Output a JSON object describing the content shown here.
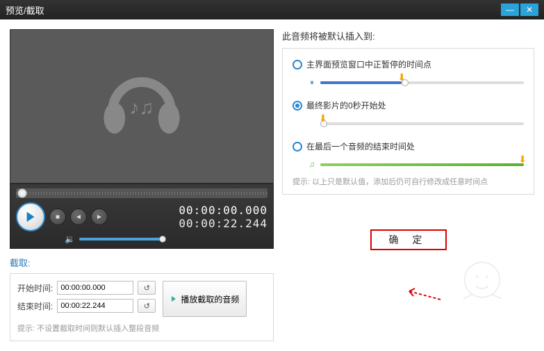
{
  "window": {
    "title": "预览/截取"
  },
  "preview": {
    "time_current": "00:00:00.000",
    "time_total": "00:00:22.244"
  },
  "cut": {
    "section_label": "截取:",
    "start_label": "开始时间:",
    "end_label": "结束时间:",
    "start_value": "00:00:00.000",
    "end_value": "00:00:22.244",
    "play_label": "播放截取的音频",
    "hint": "提示: 不设置截取时间则默认插入整段音频"
  },
  "insert": {
    "heading": "此音频将被默认插入到:",
    "options": [
      {
        "label": "主界面预览窗口中正暂停的时间点",
        "selected": false
      },
      {
        "label": "最终影片的0秒开始处",
        "selected": true
      },
      {
        "label": "在最后一个音频的结束时间处",
        "selected": false
      }
    ],
    "hint": "提示: 以上只是默认值，添加后仍可自行修改成任意时间点"
  },
  "confirm": {
    "label": "确 定"
  }
}
